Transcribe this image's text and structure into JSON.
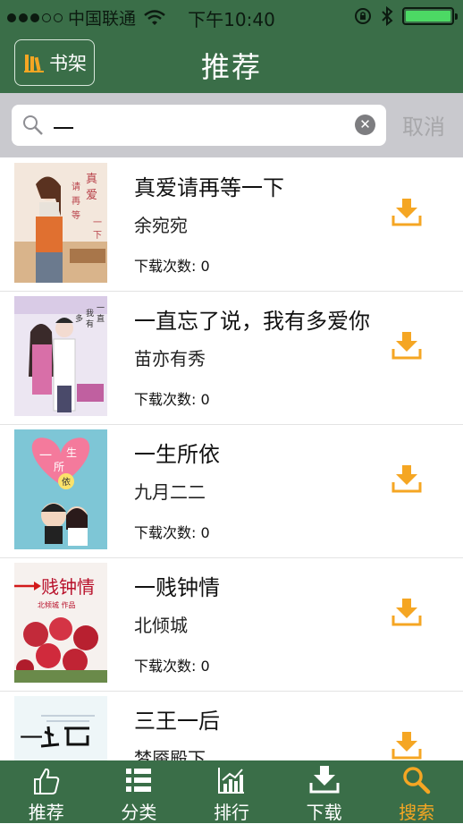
{
  "status_bar": {
    "carrier": "中国联通",
    "time": "下午10:40"
  },
  "nav": {
    "shelf_label": "书架",
    "title": "推荐"
  },
  "search": {
    "query": "一",
    "cancel_label": "取消"
  },
  "books": [
    {
      "title": "真爱请再等一下",
      "author": "余宛宛",
      "download_count": "下载次数: 0"
    },
    {
      "title": "一直忘了说，我有多爱你",
      "author": "苗亦有秀",
      "download_count": "下载次数: 0"
    },
    {
      "title": "一生所依",
      "author": "九月二二",
      "download_count": "下载次数: 0"
    },
    {
      "title": "一贱钟情",
      "author": "北倾城",
      "download_count": "下载次数: 0"
    },
    {
      "title": "三王一后",
      "author": "梦魇殿下",
      "download_count": ""
    }
  ],
  "cover_text": {
    "c2_heart_1": "一",
    "c2_heart_2": "生",
    "c2_heart_3": "所",
    "c2_heart_4": "依",
    "c3_title": "贱钟情",
    "c3_byline": "北倾城 作品"
  },
  "tabs": [
    {
      "label": "推荐",
      "icon": "thumbs-up-icon",
      "active": false
    },
    {
      "label": "分类",
      "icon": "list-icon",
      "active": false
    },
    {
      "label": "排行",
      "icon": "chart-icon",
      "active": false
    },
    {
      "label": "下载",
      "icon": "download-icon",
      "active": false
    },
    {
      "label": "搜索",
      "icon": "search-icon",
      "active": true
    }
  ],
  "colors": {
    "bar_green": "#3a6e48",
    "accent_orange": "#f5a623",
    "search_bg": "#c9c9ce"
  }
}
